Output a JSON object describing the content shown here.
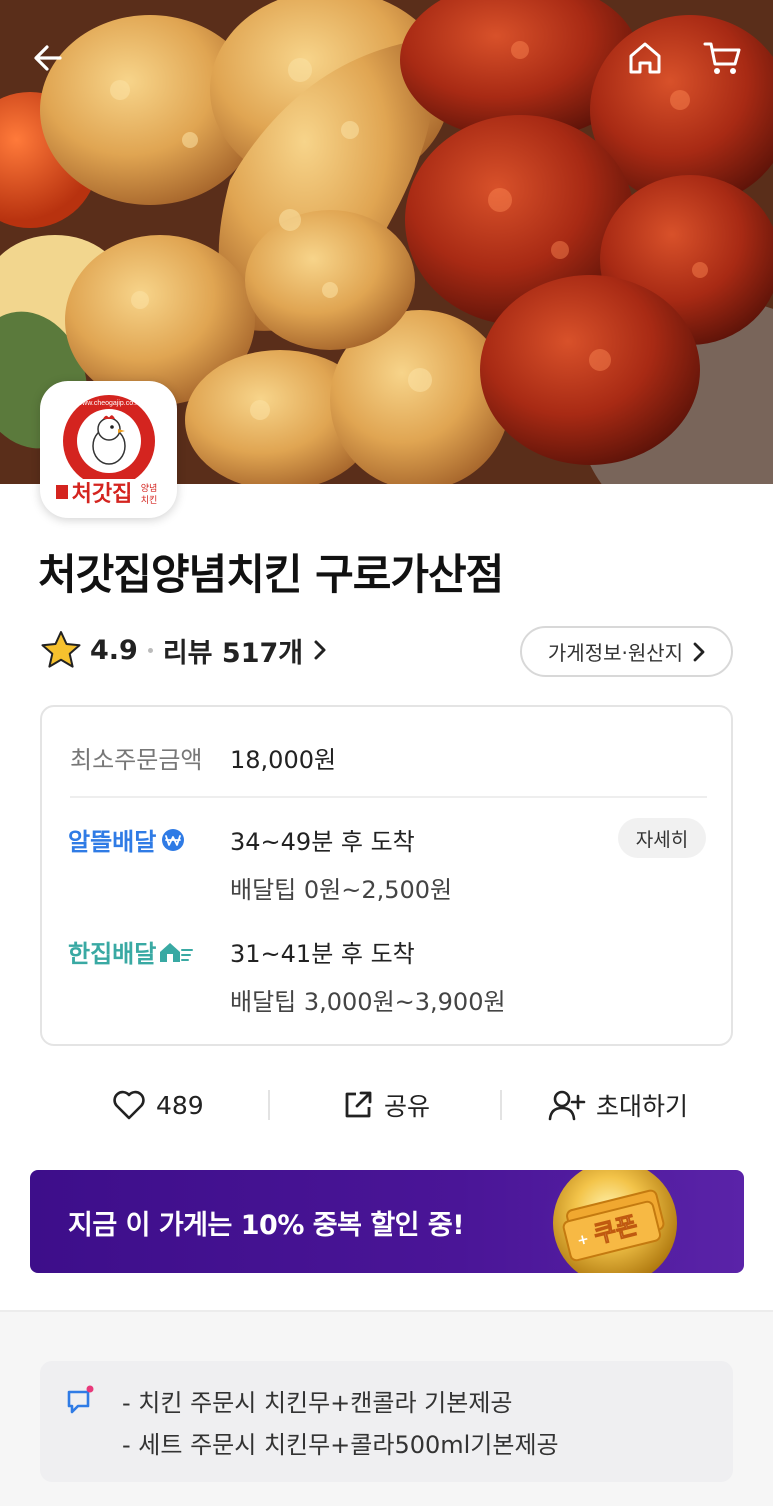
{
  "store": {
    "name": "처갓집양념치킨 구로가산점",
    "rating": "4.9",
    "review_label": "리뷰 517개",
    "info_button": "가게정보·원산지"
  },
  "logo": {
    "url_text": "www.cheogajip.co.kr",
    "brand_text": "처갓집",
    "sub_text_1": "양념",
    "sub_text_2": "치킨"
  },
  "delivery": {
    "min_order_label": "최소주문금액",
    "min_order_value": "18,000원",
    "options": [
      {
        "name": "알뜰배달",
        "time": "34~49분 후 도착",
        "tip": "배달팁 0원~2,500원",
        "color": "#2f7be5"
      },
      {
        "name": "한집배달",
        "time": "31~41분 후 도착",
        "tip": "배달팁 3,000원~3,900원",
        "color": "#39a9a3"
      }
    ],
    "detail_button": "자세히"
  },
  "actions": {
    "like_count": "489",
    "share_label": "공유",
    "invite_label": "초대하기"
  },
  "promo": {
    "text": "지금 이 가게는 10% 중복 할인 중!",
    "coupon_text": "쿠폰",
    "bg_color": "#3d0e8a"
  },
  "notice": {
    "lines": [
      "- 치킨 주문시 치킨무+캔콜라 기본제공",
      "- 세트 주문시 치킨무+콜라500ml기본제공"
    ]
  },
  "icons": [
    "back-arrow-icon",
    "home-icon",
    "cart-icon",
    "star-icon",
    "chevron-right-icon",
    "heart-icon",
    "share-icon",
    "add-person-icon",
    "chat-icon"
  ]
}
